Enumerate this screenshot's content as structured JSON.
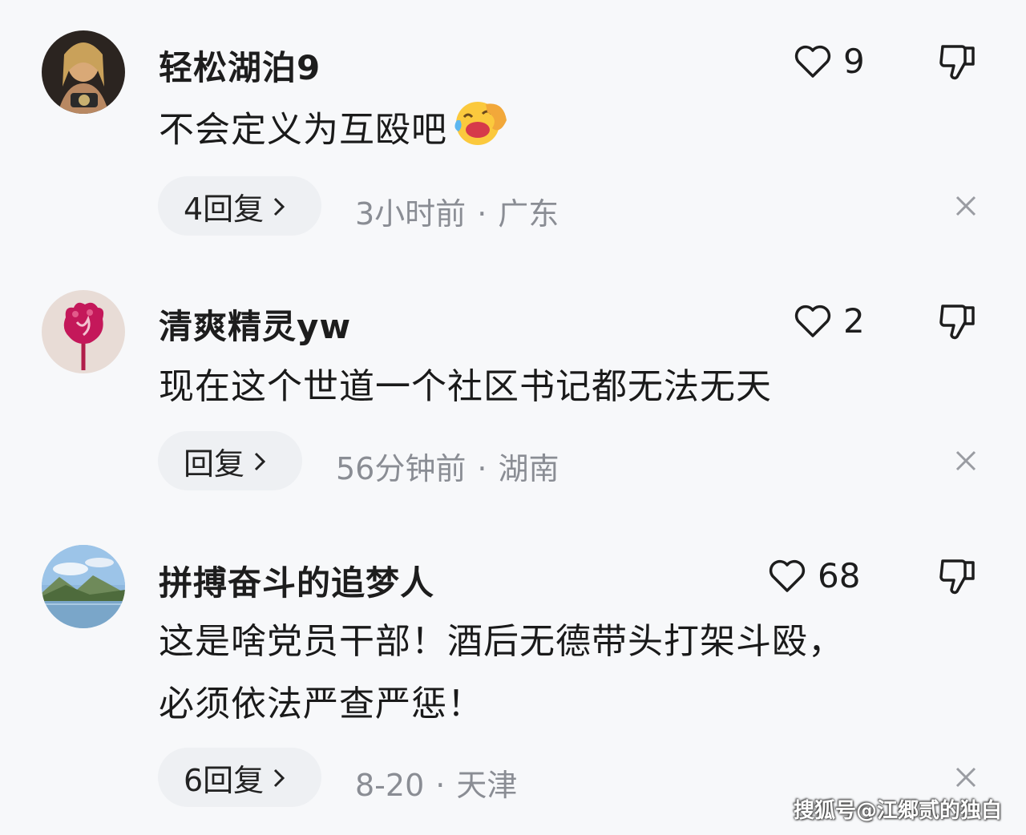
{
  "comments": [
    {
      "username": "轻松湖泊9",
      "lines": [
        "不会定义为互殴吧"
      ],
      "emoji": "laughing-crying-emoji",
      "likes": "9",
      "reply_label": "4回复",
      "time": "3小时前",
      "location": "广东",
      "avatar": "wrestler-avatar"
    },
    {
      "username": "清爽精灵yw",
      "lines": [
        "现在这个世道一个社区书记都无法无天"
      ],
      "likes": "2",
      "reply_label": "回复",
      "time": "56分钟前",
      "location": "湖南",
      "avatar": "rose-avatar"
    },
    {
      "username": "拼搏奋斗的追梦人",
      "lines": [
        "这是啥党员干部！酒后无德带头打架斗殴，",
        "必须依法严查严惩！"
      ],
      "likes": "68",
      "reply_label": "6回复",
      "time": "8-20",
      "location": "天津",
      "avatar": "landscape-avatar"
    }
  ],
  "separator": "·",
  "icons": {
    "like": "heart-icon",
    "dislike": "thumbs-down-icon",
    "reply_arrow": "chevron-right-icon",
    "dismiss": "close-icon"
  },
  "watermark": "搜狐号@江郷贰的独白",
  "colors": {
    "background": "#f7f8fa",
    "pill": "#eef0f3",
    "meta_text": "#8a8d94"
  }
}
